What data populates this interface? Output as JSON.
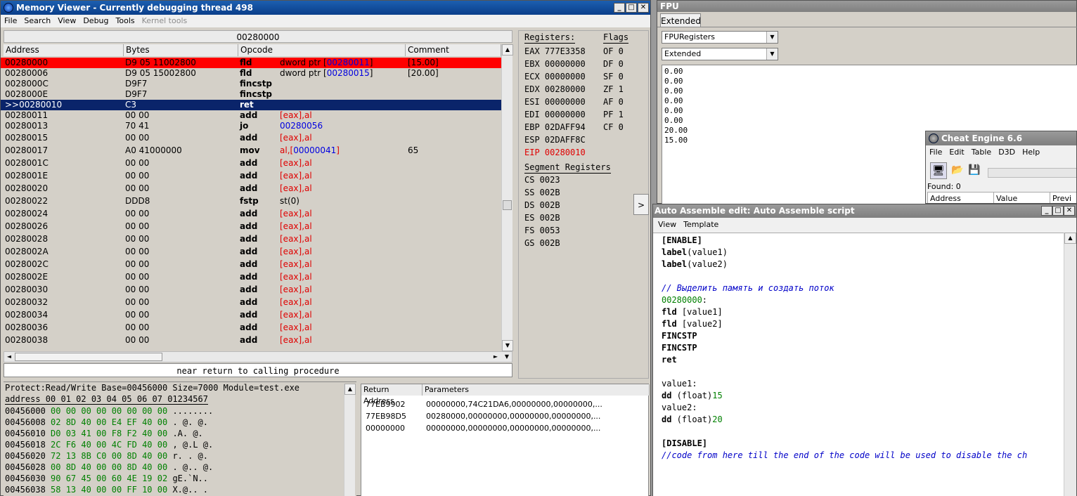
{
  "memview": {
    "title": "Memory Viewer - Currently debugging thread 498",
    "menu": [
      "File",
      "Search",
      "View",
      "Debug",
      "Tools"
    ],
    "menu_disabled": "Kernel tools",
    "address_header": "00280000",
    "columns": [
      "Address",
      "Bytes",
      "Opcode",
      "Comment"
    ],
    "rows": [
      {
        "addr": "00280000",
        "bytes": "D9 05 11002800",
        "op": "fld",
        "arg1": "dword ptr [",
        "arg2": "00280011",
        "arg3": "]",
        "com": "[15.00]"
      },
      {
        "addr": "00280006",
        "bytes": "D9 05 15002800",
        "op": "fld",
        "arg1": "dword ptr [",
        "arg2": "00280015",
        "arg3": "]",
        "com": "[20.00]"
      },
      {
        "addr": "0028000C",
        "bytes": "D9F7",
        "op": "fincstp",
        "arg1": "",
        "arg2": "",
        "arg3": "",
        "com": ""
      },
      {
        "addr": "0028000E",
        "bytes": "D9F7",
        "op": "fincstp",
        "arg1": "",
        "arg2": "",
        "arg3": "",
        "com": ""
      },
      {
        "addr": ">>00280010",
        "bytes": "C3",
        "op": "ret",
        "arg1": "",
        "arg2": "",
        "arg3": "",
        "com": ""
      },
      {
        "addr": "00280011",
        "bytes": "00 00",
        "op": "add",
        "arg1": "[eax],al",
        "arg2": "",
        "arg3": "",
        "com": ""
      },
      {
        "addr": "00280013",
        "bytes": "70 41",
        "op": "jo",
        "arg1": "",
        "arg2": "00280056",
        "arg3": "",
        "com": ""
      },
      {
        "addr": "00280015",
        "bytes": "00 00",
        "op": "add",
        "arg1": "[eax],al",
        "arg2": "",
        "arg3": "",
        "com": ""
      },
      {
        "addr": "00280017",
        "bytes": "A0 41000000",
        "op": "mov",
        "arg1": "al,[",
        "arg2": "00000041",
        "arg3": "]",
        "com": "65"
      },
      {
        "addr": "0028001C",
        "bytes": "00 00",
        "op": "add",
        "arg1": "[eax],al",
        "arg2": "",
        "arg3": "",
        "com": ""
      },
      {
        "addr": "0028001E",
        "bytes": "00 00",
        "op": "add",
        "arg1": "[eax],al",
        "arg2": "",
        "arg3": "",
        "com": ""
      },
      {
        "addr": "00280020",
        "bytes": "00 00",
        "op": "add",
        "arg1": "[eax],al",
        "arg2": "",
        "arg3": "",
        "com": ""
      },
      {
        "addr": "00280022",
        "bytes": "DDD8",
        "op": "fstp",
        "arg1": "st(0)",
        "arg2": "",
        "arg3": "",
        "com": ""
      },
      {
        "addr": "00280024",
        "bytes": "00 00",
        "op": "add",
        "arg1": "[eax],al",
        "arg2": "",
        "arg3": "",
        "com": ""
      },
      {
        "addr": "00280026",
        "bytes": "00 00",
        "op": "add",
        "arg1": "[eax],al",
        "arg2": "",
        "arg3": "",
        "com": ""
      },
      {
        "addr": "00280028",
        "bytes": "00 00",
        "op": "add",
        "arg1": "[eax],al",
        "arg2": "",
        "arg3": "",
        "com": ""
      },
      {
        "addr": "0028002A",
        "bytes": "00 00",
        "op": "add",
        "arg1": "[eax],al",
        "arg2": "",
        "arg3": "",
        "com": ""
      },
      {
        "addr": "0028002C",
        "bytes": "00 00",
        "op": "add",
        "arg1": "[eax],al",
        "arg2": "",
        "arg3": "",
        "com": ""
      },
      {
        "addr": "0028002E",
        "bytes": "00 00",
        "op": "add",
        "arg1": "[eax],al",
        "arg2": "",
        "arg3": "",
        "com": ""
      },
      {
        "addr": "00280030",
        "bytes": "00 00",
        "op": "add",
        "arg1": "[eax],al",
        "arg2": "",
        "arg3": "",
        "com": ""
      },
      {
        "addr": "00280032",
        "bytes": "00 00",
        "op": "add",
        "arg1": "[eax],al",
        "arg2": "",
        "arg3": "",
        "com": ""
      },
      {
        "addr": "00280034",
        "bytes": "00 00",
        "op": "add",
        "arg1": "[eax],al",
        "arg2": "",
        "arg3": "",
        "com": ""
      },
      {
        "addr": "00280036",
        "bytes": "00 00",
        "op": "add",
        "arg1": "[eax],al",
        "arg2": "",
        "arg3": "",
        "com": ""
      },
      {
        "addr": "00280038",
        "bytes": "00 00",
        "op": "add",
        "arg1": "[eax],al",
        "arg2": "",
        "arg3": "",
        "com": ""
      }
    ],
    "status": "near return to calling procedure",
    "registers_title": "Registers:",
    "flags_title": "Flags",
    "registers": [
      "EAX 777E3358",
      "EBX 00000000",
      "ECX 00000000",
      "EDX 00280000",
      "ESI 00000000",
      "EDI 00000000",
      "EBP 02DAFF94",
      "ESP 02DAFF8C",
      "EIP 00280010"
    ],
    "flags": [
      "OF 0",
      "DF 0",
      "SF 0",
      "ZF 1",
      "AF 0",
      "PF 1",
      "CF 0"
    ],
    "segment_title": "Segment Registers",
    "segments": [
      "CS 0023",
      "SS 002B",
      "DS 002B",
      "ES 002B",
      "FS 0053",
      "GS 002B"
    ],
    "expand_label": ">",
    "hex_info": "Protect:Read/Write  Base=00456000 Size=7000 Module=test.exe",
    "hex_header": "address  00 01 02 03 04 05 06 07 01234567",
    "hex_rows": [
      {
        "a": "00456000",
        "b": "00 00 00 00 00 00 00 00",
        "t": "........"
      },
      {
        "a": "00456008",
        "b": "02 8D 40 00 E4 EF 40 00",
        "t": ". @.  @."
      },
      {
        "a": "00456010",
        "b": "D0 03 41 00 F8 F2 40 00",
        "t": "  .A.  @."
      },
      {
        "a": "00456018",
        "b": "2C F6 40 00 4C FD 40 00",
        "t": ", @.L @."
      },
      {
        "a": "00456020",
        "b": "72 13 8B C0 00 8D 40 00",
        "t": "r.  . @."
      },
      {
        "a": "00456028",
        "b": "00 8D 40 00 00 8D 40 00",
        "t": ". @.. @."
      },
      {
        "a": "00456030",
        "b": "90 67 45 00 60 4E 19 02",
        "t": " gE.`N.."
      },
      {
        "a": "00456038",
        "b": "58 13 40 00 00 FF 10 00",
        "t": "X.@.. ."
      }
    ],
    "stack_columns": [
      "Return Address",
      "Parameters"
    ],
    "stack_rows": [
      {
        "ret": "77EB9902",
        "params": "00000000,74C21DA6,00000000,00000000,..."
      },
      {
        "ret": "77EB98D5",
        "params": "00280000,00000000,00000000,00000000,..."
      },
      {
        "ret": "00000000",
        "params": "00000000,00000000,00000000,00000000,..."
      }
    ]
  },
  "fpu": {
    "title": "FPU",
    "tab": "Extended",
    "select1": "FPURegisters",
    "select2": "Extended",
    "values": [
      "0.00",
      "0.00",
      "0.00",
      "0.00",
      "0.00",
      "0.00",
      "20.00",
      "15.00"
    ]
  },
  "ce": {
    "title": "Cheat Engine 6.6",
    "menu": [
      "File",
      "Edit",
      "Table",
      "D3D",
      "Help"
    ],
    "found": "Found: 0",
    "columns": [
      "Address",
      "Value",
      "Previ"
    ]
  },
  "aa": {
    "title": "Auto Assemble edit: Auto Assemble script",
    "menu": [
      "View",
      "Template"
    ],
    "lines": [
      [
        {
          "t": "[ENABLE]",
          "c": "k"
        }
      ],
      [
        {
          "t": "label",
          "c": "k"
        },
        {
          "t": "(value1)",
          "c": "n"
        }
      ],
      [
        {
          "t": "label",
          "c": "k"
        },
        {
          "t": "(value2)",
          "c": "n"
        }
      ],
      [],
      [
        {
          "t": "// Выделить память и создать поток",
          "c": "cm"
        }
      ],
      [
        {
          "t": "00280000",
          "c": "num"
        },
        {
          "t": ":",
          "c": "n"
        }
      ],
      [
        {
          "t": "fld",
          "c": "kb"
        },
        {
          "t": " [value1]",
          "c": "n"
        }
      ],
      [
        {
          "t": "fld",
          "c": "kb"
        },
        {
          "t": " [value2]",
          "c": "n"
        }
      ],
      [
        {
          "t": "FINCSTP",
          "c": "kb"
        }
      ],
      [
        {
          "t": "FINCSTP",
          "c": "kb"
        }
      ],
      [
        {
          "t": "ret",
          "c": "kb"
        }
      ],
      [],
      [
        {
          "t": "value1:",
          "c": "n"
        }
      ],
      [
        {
          "t": "dd",
          "c": "kb"
        },
        {
          "t": " (float)",
          "c": "n"
        },
        {
          "t": "15",
          "c": "num"
        }
      ],
      [
        {
          "t": "value2:",
          "c": "n"
        }
      ],
      [
        {
          "t": "dd",
          "c": "kb"
        },
        {
          "t": " (float)",
          "c": "n"
        },
        {
          "t": "20",
          "c": "num"
        }
      ],
      [],
      [
        {
          "t": "[DISABLE]",
          "c": "k"
        }
      ],
      [
        {
          "t": "//code from here till the end of the code will be used to disable the ch",
          "c": "cm"
        }
      ]
    ]
  },
  "colors": {
    "highlight_red": "#ff0000",
    "highlight_blue": "#0a246a",
    "register_red": "#e00000",
    "link_blue": "#0000e0",
    "code_green": "#008000"
  }
}
